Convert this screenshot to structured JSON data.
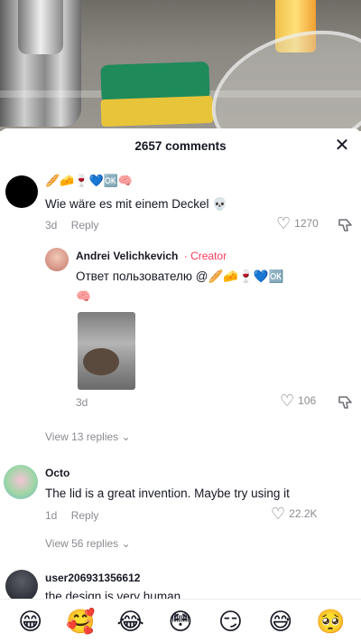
{
  "header": {
    "count": "2657 comments",
    "close": "✕"
  },
  "comments": [
    {
      "username_emojis": "🥖🧀🍷💙🆗🧠",
      "text": "Wie wäre es mit einem Deckel 💀",
      "time": "3d",
      "reply": "Reply",
      "likes": "1270"
    },
    {
      "username": "Andrei Velichkevich",
      "creator_sep": " · ",
      "creator": "Creator",
      "text": "Ответ пользователю @🥖🧀🍷💙🆗",
      "text2": "🧠",
      "time": "3d",
      "likes": "106"
    },
    {
      "view_replies": "View 13 replies ⌄"
    },
    {
      "username": "Octo",
      "text": "The lid is a great invention. Maybe try using it",
      "time": "1d",
      "reply": "Reply",
      "likes": "22.2K"
    },
    {
      "view_replies": "View 56 replies ⌄"
    },
    {
      "username": "user206931356612",
      "text": "the design is very human"
    }
  ],
  "emoji_bar": [
    "😁",
    "🥰",
    "😂",
    "😳",
    "😏",
    "😅",
    "🥺"
  ],
  "colors": {
    "creator": "#ff3b5c",
    "muted": "#8a8b91",
    "text": "#161823"
  }
}
